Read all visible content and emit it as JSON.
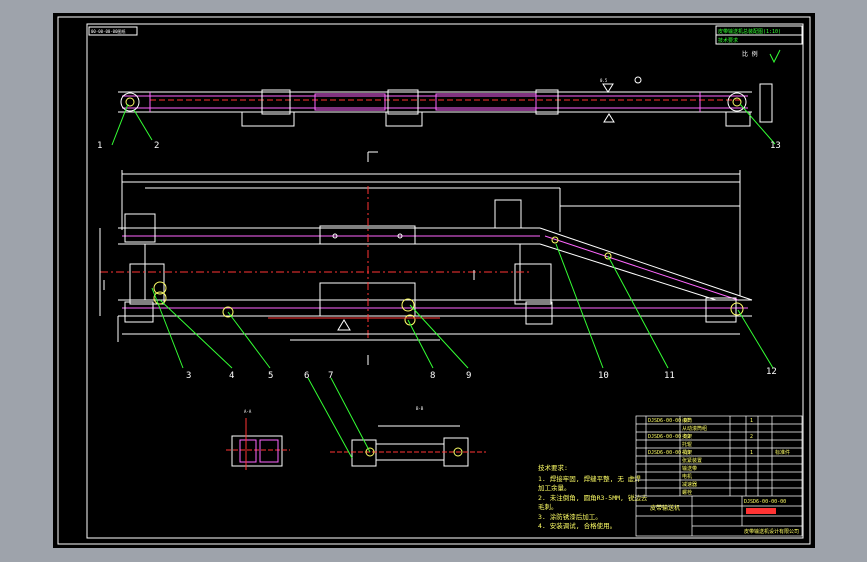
{
  "drawing": {
    "top_tag": "00-00-00-00图纸",
    "header_box": [
      "皮带输送机总装配图(1:10)",
      "技术要求"
    ],
    "ratio": "比 例",
    "notes": {
      "title": "技术要求:",
      "lines": [
        "1. 焊接牢固, 焊缝平整, 无 虚焊",
        "   加工余量。",
        "2. 未注倒角, 圆角R3-5MM, 锐边去",
        "   毛刺。",
        "3. 涂防锈漆后加工。",
        "4. 安装调试, 合格使用。"
      ]
    },
    "sections": {
      "a": "A-A",
      "b": "B-B"
    },
    "balloons": [
      "1",
      "2",
      "3",
      "4",
      "5",
      "6",
      "7",
      "8",
      "9",
      "10",
      "11",
      "12",
      "13"
    ],
    "title_block": {
      "drawing_no": "DJSD6-00-00-00",
      "name": "皮带输送机",
      "company": "皮带输送机设计有限公司",
      "mark": "标准件"
    }
  },
  "colors": {
    "bg": "#9ea3ab",
    "sheet": "#000000",
    "frame": "#ffffff",
    "outline": "#ffffff",
    "hidden": "#ff3333",
    "belt": "#ff66ff",
    "leader": "#33ff33",
    "dim": "#33ff33",
    "text": "#ffff66",
    "accent": "#0066ff"
  }
}
